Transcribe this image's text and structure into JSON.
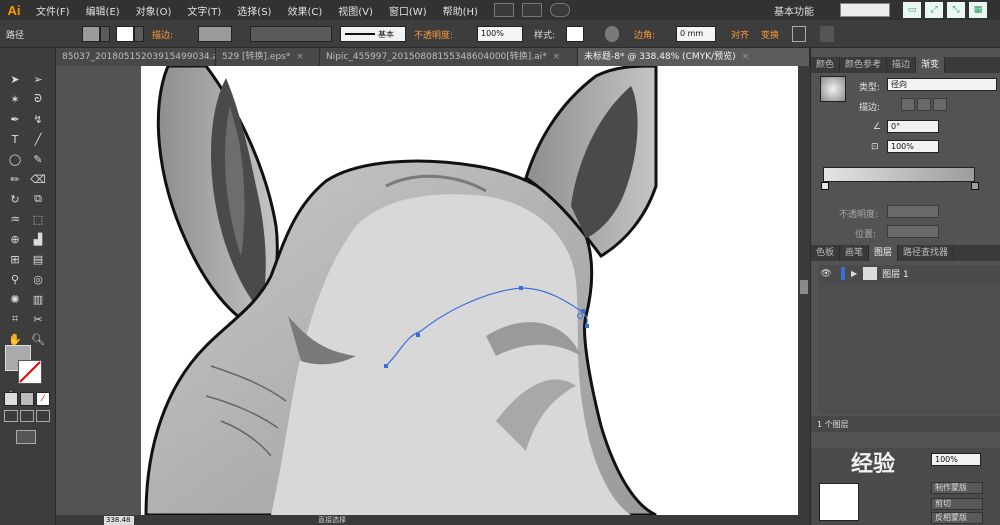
{
  "app": {
    "logo": "Ai",
    "menu": [
      "文件(F)",
      "编辑(E)",
      "对象(O)",
      "文字(T)",
      "选择(S)",
      "效果(C)",
      "视图(V)",
      "窗口(W)",
      "帮助(H)"
    ],
    "workspace": "基本功能"
  },
  "control_bar": {
    "selection_label": "路径",
    "stroke_label": "描边:",
    "stroke_style": "基本",
    "opacity_label": "不透明度:",
    "opacity_value": "100%",
    "style_label": "样式:",
    "corner_label": "边角:",
    "corner_value": "0 mm",
    "align_label": "对齐",
    "transform_label": "变换"
  },
  "tabs": [
    {
      "label": "85037_20180515203915499034.ai*"
    },
    {
      "label": "529 [转换].eps*"
    },
    {
      "label": "Nipic_455997_20150808155348604000[转换].ai*"
    },
    {
      "label": "未标题-8* @ 338.48% (CMYK/预览)"
    }
  ],
  "status": {
    "zoom": "338.48",
    "tool_status": "直接选择"
  },
  "gradient_panel": {
    "tabs": [
      "颜色",
      "颜色参考",
      "描边",
      "渐变"
    ],
    "type_label": "类型:",
    "type_value": "径向",
    "stroke_label": "描边:",
    "angle_value": "0°",
    "aspect_value": "100%",
    "opacity_label": "不透明度:",
    "position_label": "位置:"
  },
  "layers_panel": {
    "tabs": [
      "色板",
      "画笔",
      "图层",
      "路径查找器"
    ],
    "layer_name": "图层 1",
    "count": "1 个图层"
  },
  "bottom_panel": {
    "opacity_value": "100%",
    "make_mask": "制作蒙版",
    "clip": "剪切",
    "invert_mask": "反相蒙版",
    "watermark": "经验"
  },
  "colors": {
    "accent": "#ff9a00",
    "path_selection": "#3a6fd8",
    "ui_dark": "#3d3d3d"
  }
}
